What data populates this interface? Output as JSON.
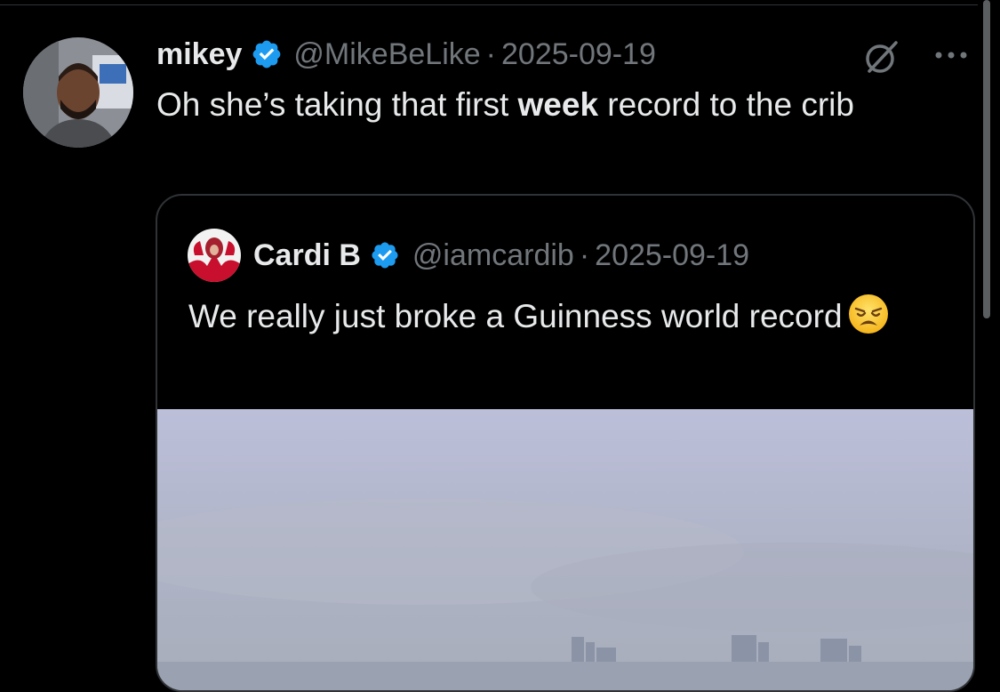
{
  "post": {
    "author": {
      "display_name": "mikey",
      "handle": "@MikeBeLike",
      "verified": true,
      "avatar_icon": "user-avatar"
    },
    "separator": "·",
    "date": "2025-09-19",
    "text_before": "Oh she’s taking that first ",
    "text_bold": "week",
    "text_after": " record to the crib",
    "actions": {
      "grok_icon": "grok-icon",
      "more_icon": "more-options-icon"
    }
  },
  "quote": {
    "author": {
      "display_name": "Cardi B",
      "handle": "@iamcardib",
      "verified": true,
      "avatar_icon": "user-avatar"
    },
    "separator": "·",
    "date": "2025-09-19",
    "text": "We really just broke a Guinness world record",
    "emoji": "weary-face-emoji",
    "media": "sky-skyline-image"
  },
  "colors": {
    "background": "#000000",
    "primary_text": "#e7e9ea",
    "secondary_text": "#71767b",
    "verified_blue": "#1d9bf0",
    "border": "#2f3336"
  }
}
